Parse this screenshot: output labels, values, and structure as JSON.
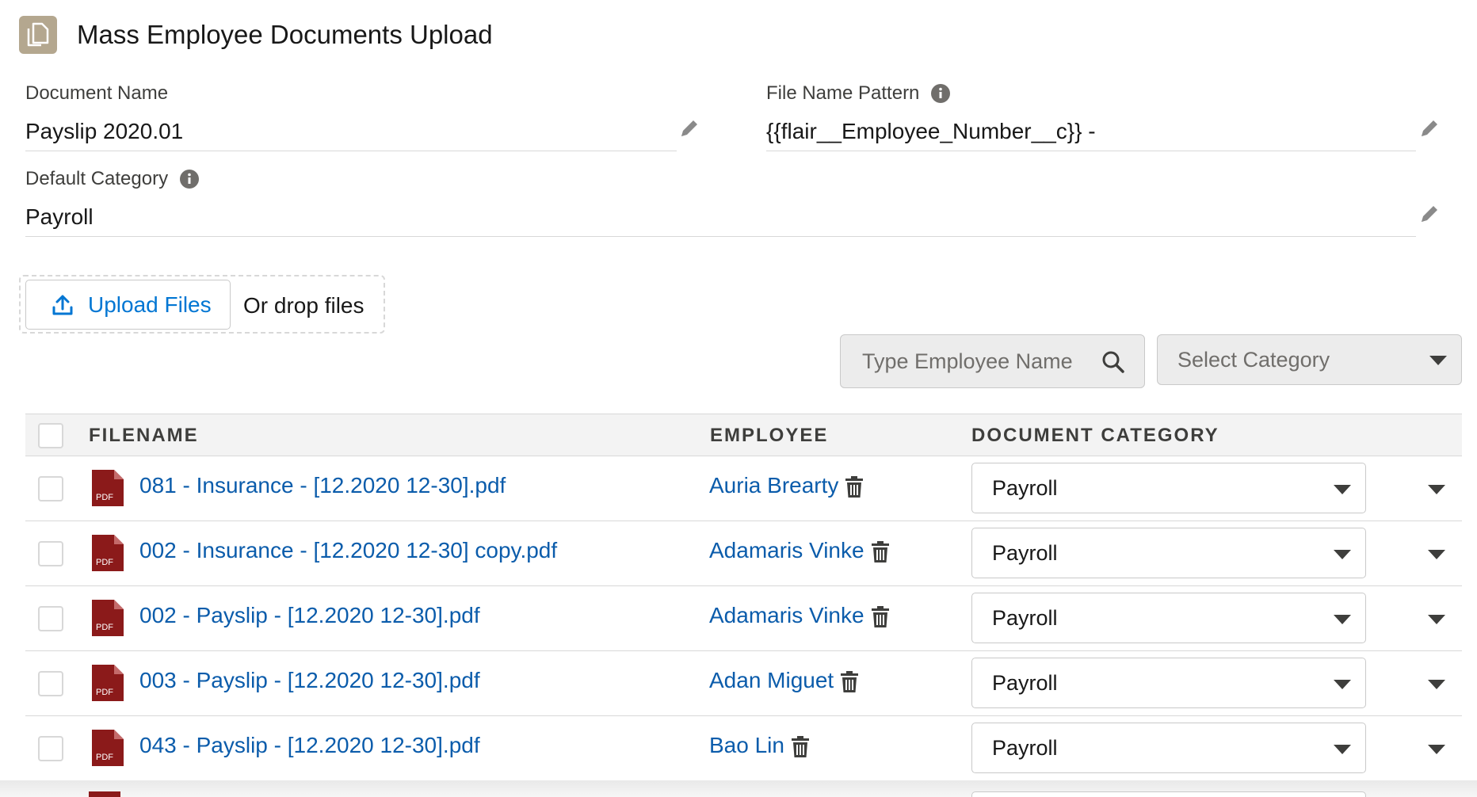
{
  "header": {
    "title": "Mass Employee Documents Upload",
    "icon": "document-icon"
  },
  "fields": {
    "document_name": {
      "label": "Document Name",
      "value": "Payslip 2020.01"
    },
    "file_name_pattern": {
      "label": "File Name Pattern",
      "value": "{{flair__Employee_Number__c}} -"
    },
    "default_category": {
      "label": "Default Category",
      "value": "Payroll"
    }
  },
  "upload": {
    "button_label": "Upload Files",
    "drop_text": "Or drop files"
  },
  "filters": {
    "search_placeholder": "Type Employee Name",
    "category_placeholder": "Select Category"
  },
  "table": {
    "columns": {
      "filename": "FILENAME",
      "employee": "EMPLOYEE",
      "category": "DOCUMENT CATEGORY"
    },
    "rows": [
      {
        "filename": "081 - Insurance - [12.2020 12-30].pdf",
        "employee": "Auria Brearty",
        "category": "Payroll",
        "file_type": "PDF"
      },
      {
        "filename": "002 - Insurance - [12.2020 12-30] copy.pdf",
        "employee": "Adamaris Vinke",
        "category": "Payroll",
        "file_type": "PDF"
      },
      {
        "filename": "002 - Payslip - [12.2020 12-30].pdf",
        "employee": "Adamaris Vinke",
        "category": "Payroll",
        "file_type": "PDF"
      },
      {
        "filename": "003 - Payslip - [12.2020 12-30].pdf",
        "employee": "Adan Miguet",
        "category": "Payroll",
        "file_type": "PDF"
      },
      {
        "filename": "043 - Payslip - [12.2020 12-30].pdf",
        "employee": "Bao Lin",
        "category": "Payroll",
        "file_type": "PDF"
      }
    ]
  },
  "colors": {
    "link": "#0b5cab",
    "brand_icon": "#b4a78f",
    "pdf": "#8b1a1a"
  }
}
